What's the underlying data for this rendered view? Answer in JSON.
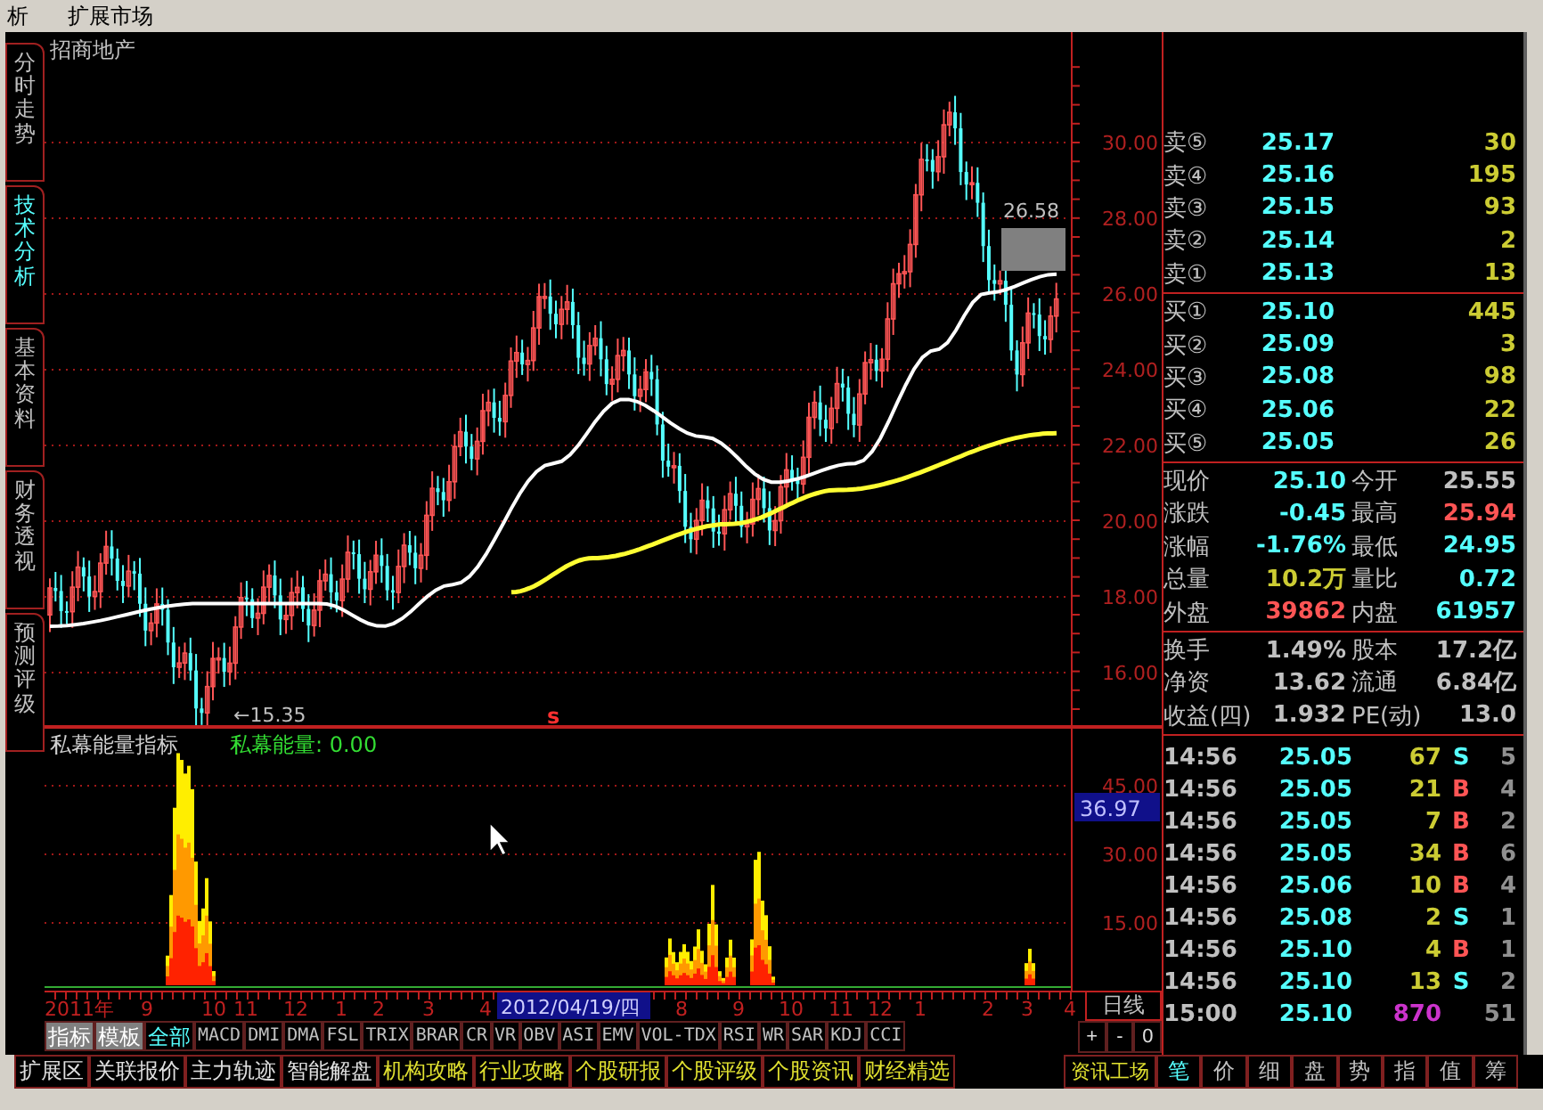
{
  "menu": [
    {
      "label": "析"
    },
    {
      "label": "扩展市场"
    }
  ],
  "side_tabs": [
    {
      "label": "分时走势",
      "selected": false
    },
    {
      "label": "技术分析",
      "selected": true
    },
    {
      "label": "基本资料",
      "selected": false
    },
    {
      "label": "财务透视",
      "selected": false
    },
    {
      "label": "预测评级",
      "selected": false
    }
  ],
  "chart": {
    "title": "招商地产",
    "y_axis": [
      "30.00",
      "28.00",
      "26.00",
      "24.00",
      "22.00",
      "20.00",
      "18.00",
      "16.00"
    ],
    "high_label": "26.58",
    "low_label": "←15.35",
    "signal": "s"
  },
  "indicator": {
    "name": "私幕能量指标",
    "reading": "私幕能量: 0.00",
    "y_axis": [
      "45.00",
      "30.00",
      "15.00"
    ],
    "cursor_value": "36.97"
  },
  "time_axis": {
    "labels": [
      {
        "text": "2011年",
        "selected": false
      },
      {
        "text": "9",
        "selected": false
      },
      {
        "text": "10",
        "selected": false
      },
      {
        "text": "11",
        "selected": false
      },
      {
        "text": "12",
        "selected": false
      },
      {
        "text": "1",
        "selected": false
      },
      {
        "text": "2",
        "selected": false
      },
      {
        "text": "3",
        "selected": false
      },
      {
        "text": "4",
        "selected": false
      },
      {
        "text": "2012/04/19/四",
        "selected": true
      },
      {
        "text": "8",
        "selected": false
      },
      {
        "text": "9",
        "selected": false
      },
      {
        "text": "10",
        "selected": false
      },
      {
        "text": "11",
        "selected": false
      },
      {
        "text": "12",
        "selected": false
      },
      {
        "text": "1",
        "selected": false
      },
      {
        "text": "2",
        "selected": false
      },
      {
        "text": "3",
        "selected": false
      },
      {
        "text": "4",
        "selected": false
      }
    ],
    "period": "日线"
  },
  "indicator_tabs": [
    {
      "label": "指标",
      "kind": "button",
      "selected": false
    },
    {
      "label": "模板",
      "kind": "button",
      "selected": false
    },
    {
      "label": "全部",
      "kind": "tab",
      "selected": true
    },
    {
      "label": "MACD",
      "kind": "tab",
      "selected": false
    },
    {
      "label": "DMI",
      "kind": "tab",
      "selected": false
    },
    {
      "label": "DMA",
      "kind": "tab",
      "selected": false
    },
    {
      "label": "FSL",
      "kind": "tab",
      "selected": false
    },
    {
      "label": "TRIX",
      "kind": "tab",
      "selected": false
    },
    {
      "label": "BRAR",
      "kind": "tab",
      "selected": false
    },
    {
      "label": "CR",
      "kind": "tab",
      "selected": false
    },
    {
      "label": "VR",
      "kind": "tab",
      "selected": false
    },
    {
      "label": "OBV",
      "kind": "tab",
      "selected": false
    },
    {
      "label": "ASI",
      "kind": "tab",
      "selected": false
    },
    {
      "label": "EMV",
      "kind": "tab",
      "selected": false
    },
    {
      "label": "VOL-TDX",
      "kind": "tab",
      "selected": false
    },
    {
      "label": "RSI",
      "kind": "tab",
      "selected": false
    },
    {
      "label": "WR",
      "kind": "tab",
      "selected": false
    },
    {
      "label": "SAR",
      "kind": "tab",
      "selected": false
    },
    {
      "label": "KDJ",
      "kind": "tab",
      "selected": false
    },
    {
      "label": "CCI",
      "kind": "tab",
      "selected": false
    }
  ],
  "zoom_buttons": [
    "+",
    "-",
    "0"
  ],
  "order_book": {
    "sell": [
      {
        "label": "卖⑤",
        "price": "25.17",
        "volume": "30"
      },
      {
        "label": "卖④",
        "price": "25.16",
        "volume": "195"
      },
      {
        "label": "卖③",
        "price": "25.15",
        "volume": "93"
      },
      {
        "label": "卖②",
        "price": "25.14",
        "volume": "2"
      },
      {
        "label": "卖①",
        "price": "25.13",
        "volume": "13"
      }
    ],
    "buy": [
      {
        "label": "买①",
        "price": "25.10",
        "volume": "445"
      },
      {
        "label": "买②",
        "price": "25.09",
        "volume": "3"
      },
      {
        "label": "买③",
        "price": "25.08",
        "volume": "98"
      },
      {
        "label": "买④",
        "price": "25.06",
        "volume": "22"
      },
      {
        "label": "买⑤",
        "price": "25.05",
        "volume": "26"
      }
    ]
  },
  "quote": [
    {
      "cells": [
        {
          "label": "现价",
          "value": "25.10",
          "kind": "down"
        },
        {
          "label": "今开",
          "value": "25.55",
          "kind": "flat"
        }
      ]
    },
    {
      "cells": [
        {
          "label": "涨跌",
          "value": "-0.45",
          "kind": "down"
        },
        {
          "label": "最高",
          "value": "25.94",
          "kind": "up"
        }
      ]
    },
    {
      "cells": [
        {
          "label": "涨幅",
          "value": "-1.76%",
          "kind": "down"
        },
        {
          "label": "最低",
          "value": "24.95",
          "kind": "down"
        }
      ]
    },
    {
      "cells": [
        {
          "label": "总量",
          "value": "10.2万",
          "kind": "volume"
        },
        {
          "label": "量比",
          "value": "0.72",
          "kind": "down"
        }
      ]
    },
    {
      "cells": [
        {
          "label": "外盘",
          "value": "39862",
          "kind": "up"
        },
        {
          "label": "内盘",
          "value": "61957",
          "kind": "down"
        }
      ]
    }
  ],
  "extra": [
    {
      "label": "换手",
      "value": "1.49%",
      "label2": "股本",
      "value2": "17.2亿"
    },
    {
      "label": "净资",
      "value": "13.62",
      "label2": "流通",
      "value2": "6.84亿"
    },
    {
      "label": "收益(四)",
      "value": "1.932",
      "label2": "PE(动)",
      "value2": "13.0"
    }
  ],
  "ticks": [
    {
      "time": "14:56",
      "price": "25.05",
      "volume": "67",
      "kind": "sell",
      "side": "S",
      "count": "5"
    },
    {
      "time": "14:56",
      "price": "25.05",
      "volume": "21",
      "kind": "buy",
      "side": "B",
      "count": "4"
    },
    {
      "time": "14:56",
      "price": "25.05",
      "volume": "7",
      "kind": "buy",
      "side": "B",
      "count": "2"
    },
    {
      "time": "14:56",
      "price": "25.05",
      "volume": "34",
      "kind": "buy",
      "side": "B",
      "count": "6"
    },
    {
      "time": "14:56",
      "price": "25.06",
      "volume": "10",
      "kind": "buy",
      "side": "B",
      "count": "4"
    },
    {
      "time": "14:56",
      "price": "25.08",
      "volume": "2",
      "kind": "sell",
      "side": "S",
      "count": "1"
    },
    {
      "time": "14:56",
      "price": "25.10",
      "volume": "4",
      "kind": "buy",
      "side": "B",
      "count": "1"
    },
    {
      "time": "14:56",
      "price": "25.10",
      "volume": "13",
      "kind": "sell",
      "side": "S",
      "count": "2"
    },
    {
      "time": "15:00",
      "price": "25.10",
      "volume": "870",
      "kind": "close",
      "count": "51"
    }
  ],
  "bottom_tabs": [
    {
      "label": "扩展区",
      "kind": "tool"
    },
    {
      "label": "关联报价",
      "kind": "tool"
    },
    {
      "label": "主力轨迹",
      "kind": "tool"
    },
    {
      "label": "智能解盘",
      "kind": "tool"
    },
    {
      "label": "机构攻略",
      "kind": "info"
    },
    {
      "label": "行业攻略",
      "kind": "info"
    },
    {
      "label": "个股研报",
      "kind": "info"
    },
    {
      "label": "个股评级",
      "kind": "info"
    },
    {
      "label": "个股资讯",
      "kind": "info"
    },
    {
      "label": "财经精选",
      "kind": "info"
    }
  ],
  "info_button": "资讯工场",
  "panel_tabs": [
    {
      "label": "笔",
      "selected": true
    },
    {
      "label": "价",
      "selected": false
    },
    {
      "label": "细",
      "selected": false
    },
    {
      "label": "盘",
      "selected": false
    },
    {
      "label": "势",
      "selected": false
    },
    {
      "label": "指",
      "selected": false
    },
    {
      "label": "值",
      "selected": false
    },
    {
      "label": "筹",
      "selected": false
    }
  ]
}
